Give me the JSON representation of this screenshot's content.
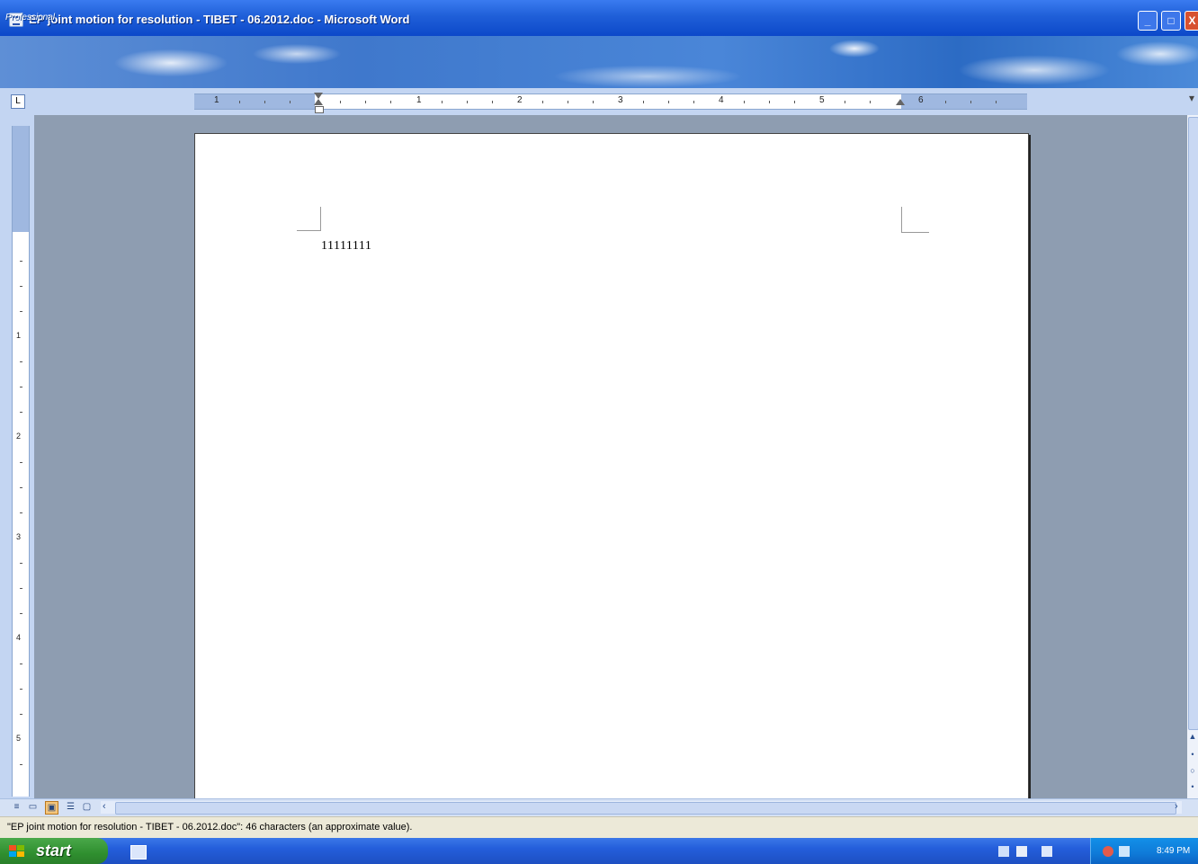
{
  "window": {
    "title": "EP joint motion for resolution - TIBET - 06.2012.doc - Microsoft Word",
    "minimize_label": "_",
    "maximize_label": "□",
    "close_label": "X"
  },
  "banner": {
    "label": "Professional"
  },
  "ruler": {
    "tab_selector": "L",
    "numbers": [
      "1",
      "1",
      "2",
      "3",
      "4",
      "5",
      "6"
    ]
  },
  "vertical_ruler": {
    "numbers": [
      "1",
      "2",
      "3",
      "4",
      "5"
    ]
  },
  "document": {
    "body_text": "11111111"
  },
  "view_buttons": [
    "≡",
    "▭",
    "▣",
    "☰",
    "▢"
  ],
  "status_bar": {
    "text": "\"EP joint motion for resolution - TIBET - 06.2012.doc\": 46 characters (an approximate value)."
  },
  "taskbar": {
    "start_label": "start",
    "clock": "8:49 PM"
  },
  "colors": {
    "title_bar": "#0c48c9",
    "workspace": "#8e9db1",
    "ruler_bg": "#c3d5f2",
    "taskbar": "#245edb",
    "start_button": "#2f8f2f"
  }
}
